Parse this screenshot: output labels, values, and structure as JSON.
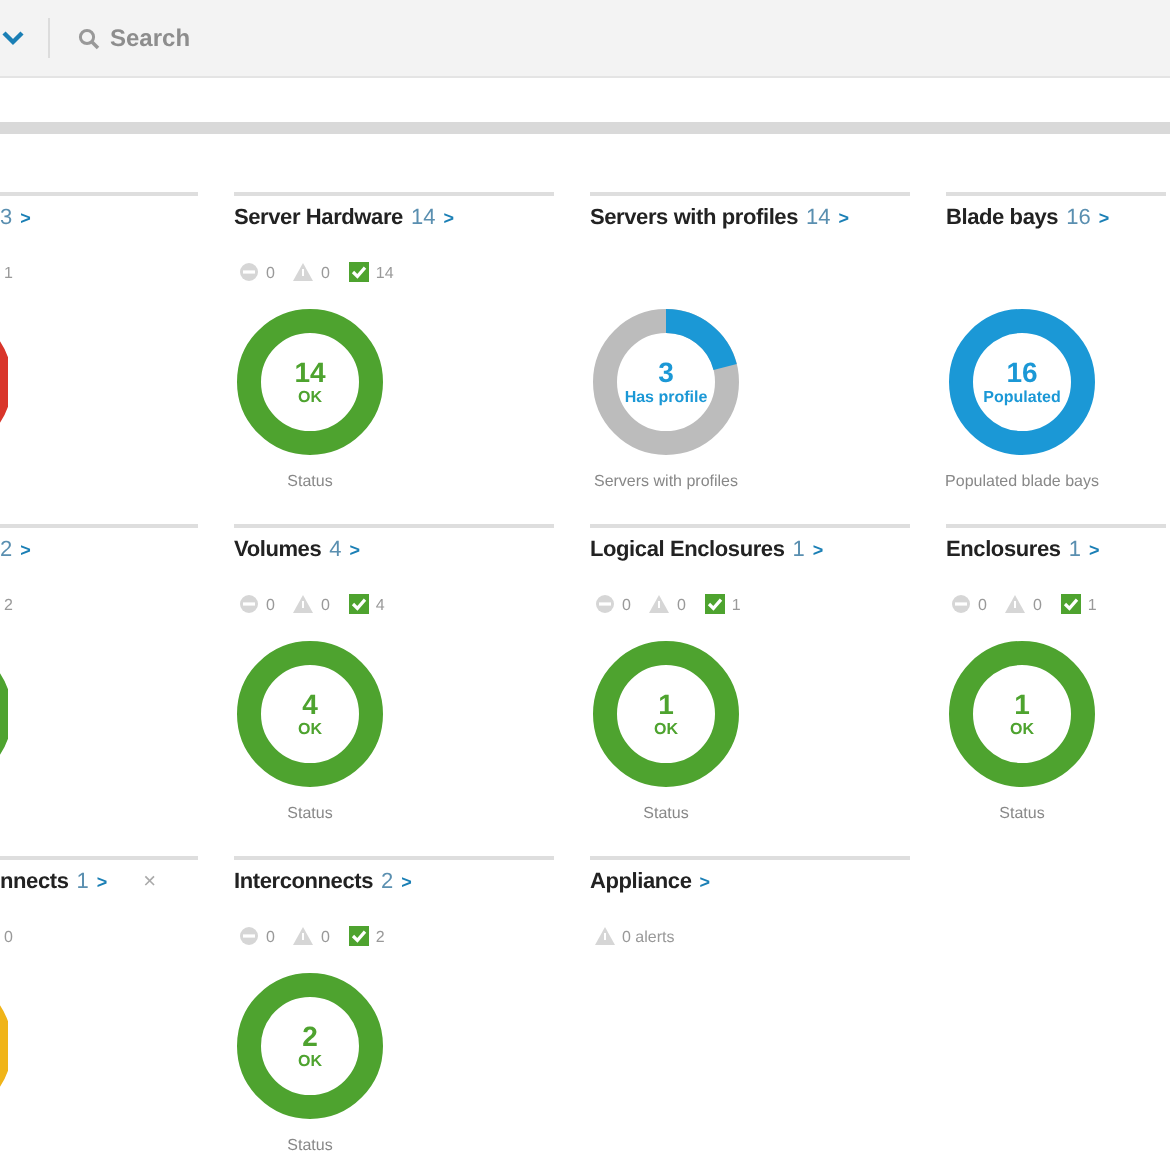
{
  "toolbar": {
    "search": {
      "placeholder": "Search"
    }
  },
  "cards": [
    {
      "cut": true,
      "count": "3",
      "arrow": ">",
      "alerts": [
        {
          "value": "1"
        }
      ],
      "donut": {
        "color": "#d9352a"
      }
    },
    {
      "title": "Server Hardware",
      "count": "14",
      "arrow": ">",
      "alerts": [
        {
          "kind": "critical",
          "value": "0"
        },
        {
          "kind": "warning",
          "value": "0"
        },
        {
          "kind": "ok",
          "value": "14"
        }
      ],
      "donut": {
        "color": "#4ea32f",
        "level": 1,
        "value": "14",
        "label": "OK",
        "caption": "Status"
      }
    },
    {
      "title": "Servers with profiles",
      "count": "14",
      "arrow": ">",
      "donut": {
        "color": "#1b98d6",
        "level": 0.21,
        "value": "3",
        "label": "Has profile",
        "caption": "Servers with profiles"
      }
    },
    {
      "title": "Blade bays",
      "count": "16",
      "arrow": ">",
      "donut": {
        "color": "#1b98d6",
        "level": 1,
        "value": "16",
        "label": "Populated",
        "caption": "Populated blade bays"
      }
    },
    {
      "cut": true,
      "count": "2",
      "arrow": ">",
      "alerts": [
        {
          "value": "2"
        }
      ],
      "donut": {
        "color": "#4ea32f"
      }
    },
    {
      "title": "Volumes",
      "count": "4",
      "arrow": ">",
      "alerts": [
        {
          "kind": "critical",
          "value": "0"
        },
        {
          "kind": "warning",
          "value": "0"
        },
        {
          "kind": "ok",
          "value": "4"
        }
      ],
      "donut": {
        "color": "#4ea32f",
        "level": 1,
        "value": "4",
        "label": "OK",
        "caption": "Status"
      }
    },
    {
      "title": "Logical Enclosures",
      "count": "1",
      "arrow": ">",
      "alerts": [
        {
          "kind": "critical",
          "value": "0"
        },
        {
          "kind": "warning",
          "value": "0"
        },
        {
          "kind": "ok",
          "value": "1"
        }
      ],
      "donut": {
        "color": "#4ea32f",
        "level": 1,
        "value": "1",
        "label": "OK",
        "caption": "Status"
      }
    },
    {
      "title": "Enclosures",
      "count": "1",
      "arrow": ">",
      "alerts": [
        {
          "kind": "critical",
          "value": "0"
        },
        {
          "kind": "warning",
          "value": "0"
        },
        {
          "kind": "ok",
          "value": "1"
        }
      ],
      "donut": {
        "color": "#4ea32f",
        "level": 1,
        "value": "1",
        "label": "OK",
        "caption": "Status"
      }
    },
    {
      "cut": true,
      "title": "nnects",
      "count": "1",
      "arrow": ">",
      "close": "×",
      "alerts": [
        {
          "value": "0"
        }
      ],
      "donut": {
        "color": "#f0b418"
      }
    },
    {
      "title": "Interconnects",
      "count": "2",
      "arrow": ">",
      "alerts": [
        {
          "kind": "critical",
          "value": "0"
        },
        {
          "kind": "warning",
          "value": "0"
        },
        {
          "kind": "ok",
          "value": "2"
        }
      ],
      "donut": {
        "color": "#4ea32f",
        "level": 1,
        "value": "2",
        "label": "OK",
        "caption": "Status"
      }
    },
    {
      "title": "Appliance",
      "arrow": ">",
      "alerts": [
        {
          "kind": "warning",
          "value": "0 alerts"
        }
      ]
    }
  ]
}
